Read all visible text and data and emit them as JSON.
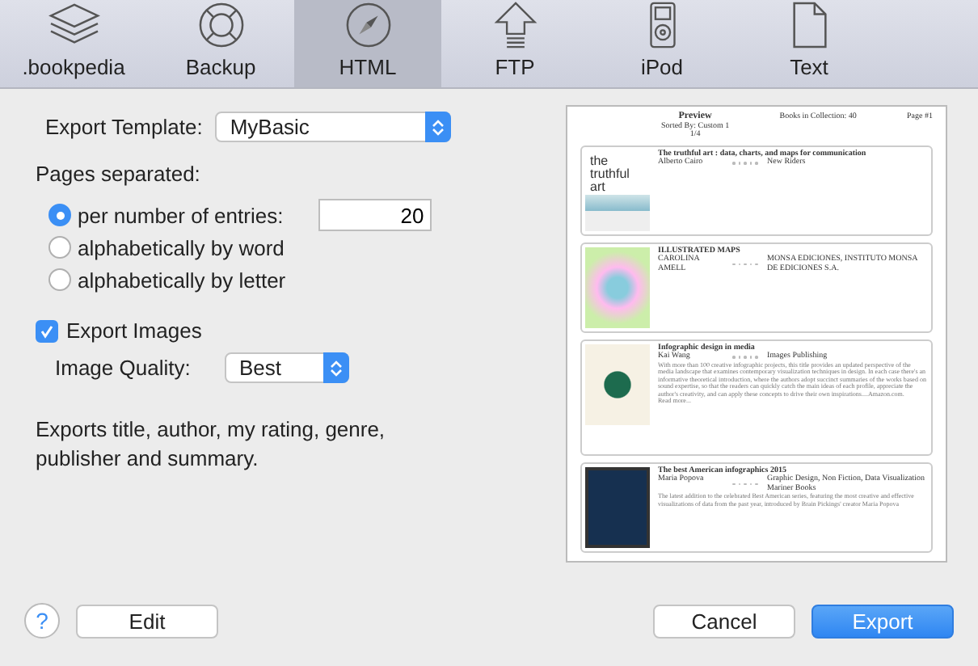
{
  "toolbar": [
    {
      "label": ".bookpedia",
      "kind": "layers",
      "selected": false
    },
    {
      "label": "Backup",
      "kind": "lifebuoy",
      "selected": false
    },
    {
      "label": "HTML",
      "kind": "compass",
      "selected": true
    },
    {
      "label": "FTP",
      "kind": "upload",
      "selected": false
    },
    {
      "label": "iPod",
      "kind": "ipod",
      "selected": false
    },
    {
      "label": "Text",
      "kind": "document",
      "selected": false
    }
  ],
  "export_template": {
    "label": "Export Template:",
    "value": "MyBasic"
  },
  "pages_separated": {
    "label": "Pages separated:",
    "options": [
      {
        "label": "per number of entries:",
        "selected": true,
        "value": "20"
      },
      {
        "label": "alphabetically by word",
        "selected": false
      },
      {
        "label": "alphabetically by letter",
        "selected": false
      }
    ]
  },
  "export_images": {
    "label": "Export Images",
    "checked": true
  },
  "image_quality": {
    "label": "Image Quality:",
    "value": "Best"
  },
  "description": "Exports title, author, my rating, genre, publisher and summary.",
  "preview": {
    "title": "Preview",
    "subtitle": "Sorted By: Custom 1",
    "pages": "1/4",
    "count": "Books in Collection: 40",
    "page": "Page #1",
    "entries": [
      {
        "kind": "text",
        "title": "The truthful art : data, charts, and maps for communication",
        "author": "Alberto Cairo",
        "stars": 0,
        "publisher": "New Riders",
        "cover_text": "the truthful art"
      },
      {
        "kind": "map",
        "title": "ILLUSTRATED MAPS",
        "author": "CAROLINA AMELL",
        "stars": 0,
        "publisher": "MONSA EDICIONES, INSTITUTO MONSA DE EDICIONES S.A."
      },
      {
        "kind": "dots",
        "title": "Infographic design in media",
        "author": "Kai Wang",
        "stars": 0,
        "publisher": "Images Publishing",
        "summary": "With more than 100 creative infographic projects, this title provides an updated perspective of the media landscape that examines contemporary visualization techniques in design. In each case there's an informative theoretical introduction, where the authors adopt succinct summaries of the works based on sound expertise, so that the readers can quickly catch the main ideas of each profile, appreciate the author's creativity, and can apply these concepts to drive their own inspirations....Amazon.com.",
        "more": "Read more..."
      },
      {
        "kind": "dark",
        "title": "The best American infographics 2015",
        "author": "Maria Popova",
        "stars": 0,
        "publisher": "Graphic Design, Non Fiction, Data Visualization Mariner Books",
        "summary": "The latest addition to the celebrated Best American series, featuring the most creative and effective visualizations of data from the past year, introduced by Brain Pickings' creator Maria Popova"
      }
    ]
  },
  "buttons": {
    "help": "?",
    "edit": "Edit",
    "cancel": "Cancel",
    "export": "Export"
  }
}
